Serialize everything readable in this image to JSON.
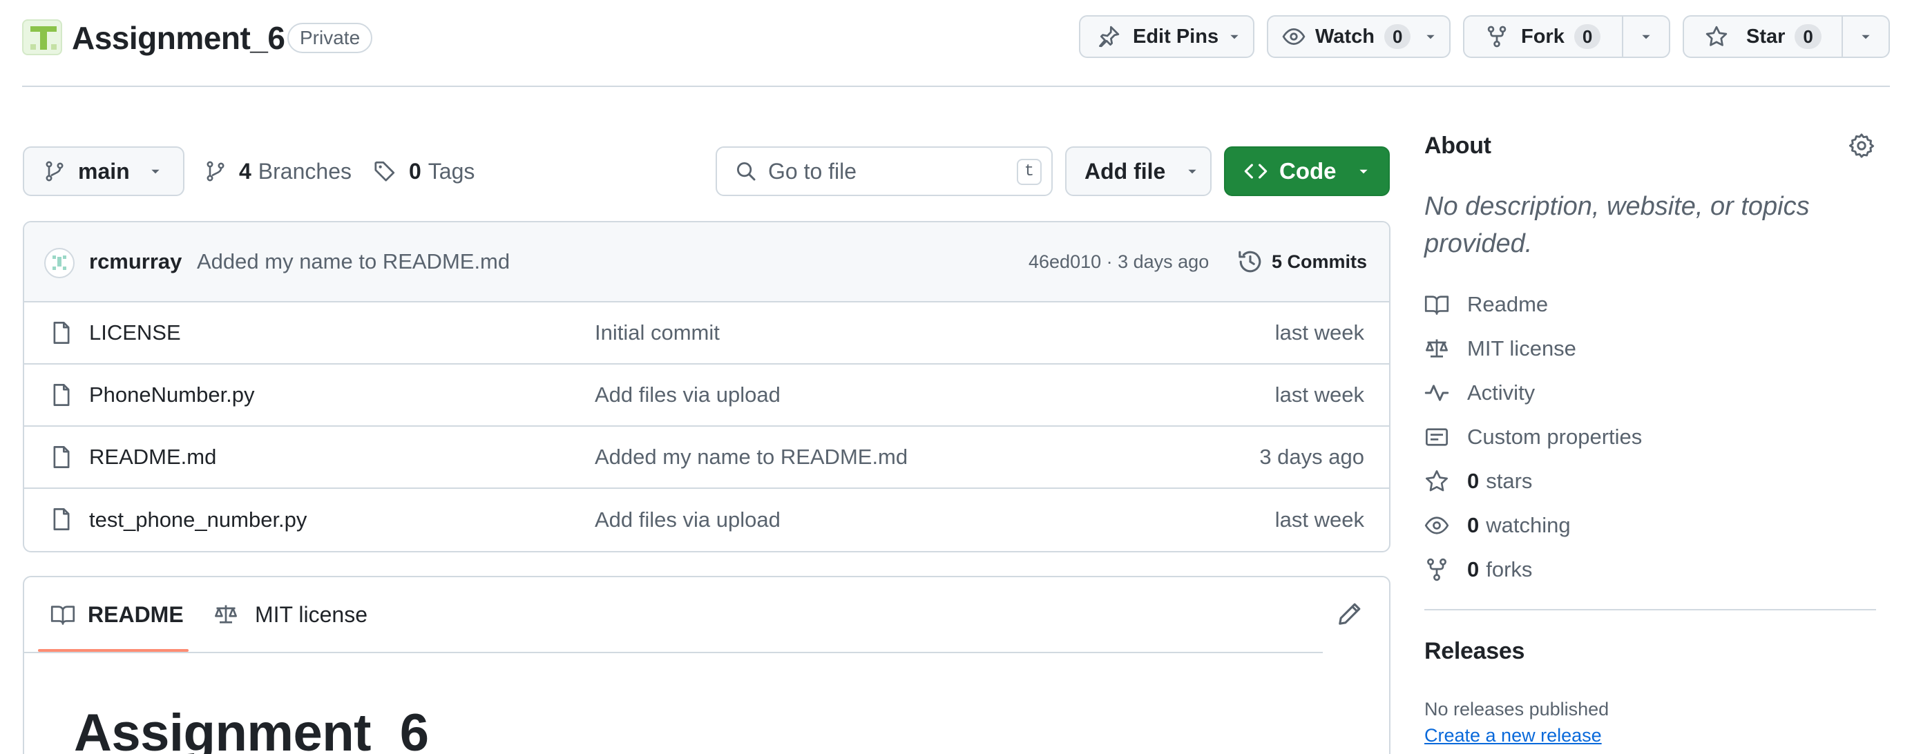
{
  "repo": {
    "name": "Assignment_6",
    "visibility": "Private"
  },
  "header_actions": {
    "edit_pins": "Edit Pins",
    "watch": "Watch",
    "watch_count": "0",
    "fork": "Fork",
    "fork_count": "0",
    "star": "Star",
    "star_count": "0"
  },
  "toolbar": {
    "branch": "main",
    "branches_count": "4",
    "branches_label": "Branches",
    "tags_count": "0",
    "tags_label": "Tags",
    "search_placeholder": "Go to file",
    "search_shortcut": "t",
    "add_file": "Add file",
    "code": "Code"
  },
  "latest_commit": {
    "author": "rcmurray",
    "message": "Added my name to README.md",
    "hash_time": "46ed010 · 3 days ago",
    "commits_label": "5 Commits"
  },
  "files": [
    {
      "name": "LICENSE",
      "message": "Initial commit",
      "date": "last week"
    },
    {
      "name": "PhoneNumber.py",
      "message": "Add files via upload",
      "date": "last week"
    },
    {
      "name": "README.md",
      "message": "Added my name to README.md",
      "date": "3 days ago"
    },
    {
      "name": "test_phone_number.py",
      "message": "Add files via upload",
      "date": "last week"
    }
  ],
  "readme": {
    "tab_readme": "README",
    "tab_license": "MIT license",
    "heading": "Assignment_6"
  },
  "about": {
    "title": "About",
    "description": "No description, website, or topics provided.",
    "readme": "Readme",
    "license": "MIT license",
    "activity": "Activity",
    "custom_properties": "Custom properties",
    "stars_count": "0",
    "stars_label": "stars",
    "watching_count": "0",
    "watching_label": "watching",
    "forks_count": "0",
    "forks_label": "forks"
  },
  "releases": {
    "title": "Releases",
    "none": "No releases published",
    "create_link": "Create a new release"
  },
  "colors": {
    "accent_green": "#1f883d",
    "link_blue": "#0969da",
    "tab_underline": "#fd8c73",
    "border": "#d1d9e0"
  },
  "icons": [
    "repo-avatar",
    "pin-icon",
    "eye-icon",
    "fork-icon",
    "star-icon",
    "branch-icon",
    "tag-icon",
    "search-icon",
    "code-icon",
    "history-icon",
    "file-icon",
    "book-icon",
    "law-icon",
    "pulse-icon",
    "note-icon",
    "gear-icon",
    "pencil-icon",
    "triangle-down-icon"
  ]
}
